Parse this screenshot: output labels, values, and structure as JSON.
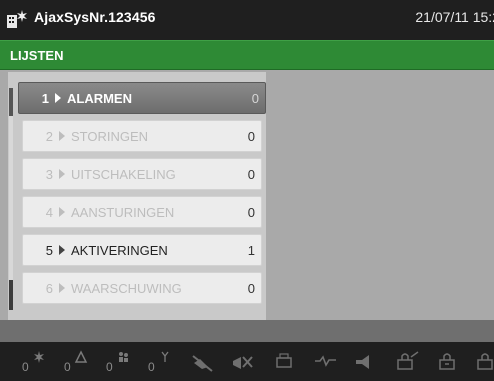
{
  "header": {
    "title": "AjaxSysNr.123456",
    "datetime": "21/07/11 15:2"
  },
  "section": {
    "label": "LIJSTEN"
  },
  "list": {
    "items": [
      {
        "num": "1",
        "label": "ALARMEN",
        "count": "0"
      },
      {
        "num": "2",
        "label": "STORINGEN",
        "count": "0"
      },
      {
        "num": "3",
        "label": "UITSCHAKELING",
        "count": "0"
      },
      {
        "num": "4",
        "label": "AANSTURINGEN",
        "count": "0"
      },
      {
        "num": "5",
        "label": "AKTIVERINGEN",
        "count": "1"
      },
      {
        "num": "6",
        "label": "WAARSCHUWING",
        "count": "0"
      }
    ]
  },
  "status_icons": {
    "counts": [
      "0",
      "0",
      "0",
      "0"
    ]
  }
}
